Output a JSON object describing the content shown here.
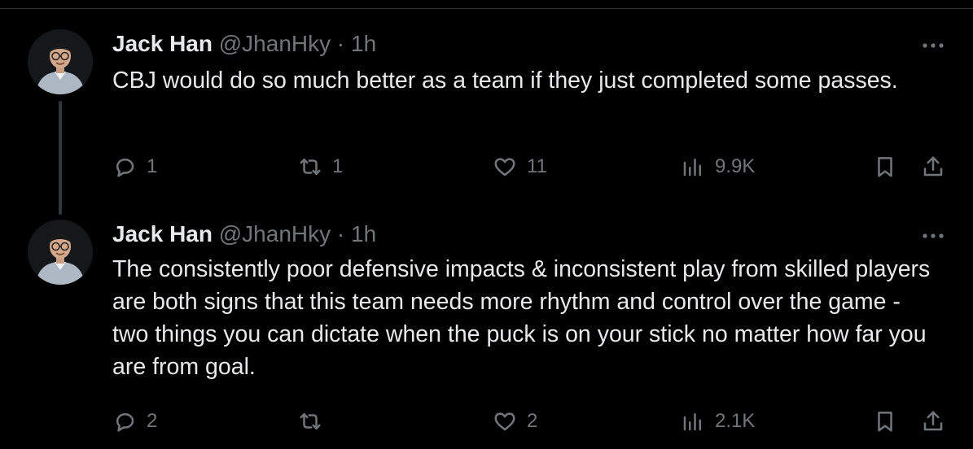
{
  "tweets": [
    {
      "author_name": "Jack Han",
      "handle": "@JhanHky",
      "separator": "·",
      "time": "1h",
      "text": "CBJ would do so much better as a team if they just completed some passes.",
      "replies": "1",
      "retweets": "1",
      "likes": "11",
      "views": "9.9K"
    },
    {
      "author_name": "Jack Han",
      "handle": "@JhanHky",
      "separator": "·",
      "time": "1h",
      "text": "The consistently poor defensive impacts & inconsistent play from skilled players are both signs that this team needs more rhythm and control over the game - two things you can dictate when the puck is on your stick no matter how far you are from goal.",
      "replies": "2",
      "retweets": "",
      "likes": "2",
      "views": "2.1K"
    }
  ],
  "icons": {
    "more": "more-horizontal-icon",
    "reply": "reply-bubble-icon",
    "retweet": "retweet-arrows-icon",
    "like": "heart-icon",
    "views": "views-chart-icon",
    "bookmark": "bookmark-icon",
    "share": "share-upload-icon"
  },
  "colors": {
    "background": "#000000",
    "text_primary": "#e7e9ea",
    "text_secondary": "#71767b",
    "thread_line": "#333639",
    "border": "#2f3336"
  }
}
